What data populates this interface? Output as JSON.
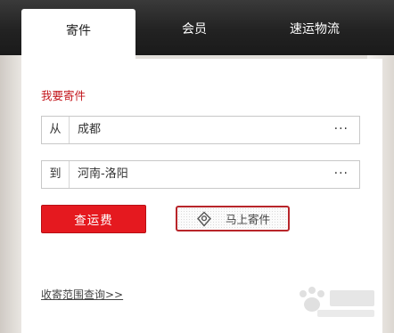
{
  "tabs": [
    {
      "label": "寄件",
      "active": true
    },
    {
      "label": "会员",
      "active": false
    },
    {
      "label": "速运物流",
      "active": false
    }
  ],
  "form": {
    "section_title": "我要寄件",
    "from": {
      "label": "从",
      "value": "成都",
      "more": "···"
    },
    "to": {
      "label": "到",
      "value": "河南-洛阳",
      "more": "···"
    }
  },
  "buttons": {
    "query_fee": "查运费",
    "ship_now": "马上寄件"
  },
  "links": {
    "range_query": "收寄范围查询>>"
  },
  "icons": {
    "ship_now": "location-pin-icon",
    "more": "ellipsis-icon"
  },
  "colors": {
    "accent": "#e5191f",
    "title_red": "#c3161c",
    "tabbar": "#222222"
  }
}
